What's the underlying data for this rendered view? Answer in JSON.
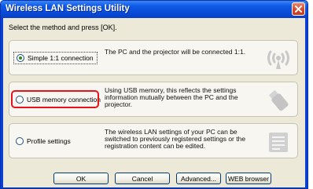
{
  "window": {
    "title": "Wireless LAN Settings Utility",
    "title_bar_color": "#0a3fd6",
    "close_icon": "close-icon"
  },
  "instruction": "Select the method and press [OK].",
  "options": [
    {
      "label": "Simple 1:1 connection",
      "selected": true,
      "description": "The PC and the projector will be connected 1:1.",
      "icon": "wireless-signal-icon"
    },
    {
      "label": "USB memory connection",
      "selected": false,
      "highlighted": true,
      "highlight_color": "#e8121a",
      "description": "Using USB memory, this reflects the settings information mutually between the PC and the projector.",
      "icon": "usb-memory-icon"
    },
    {
      "label": "Profile settings",
      "selected": false,
      "description": "The wireless LAN settings of your PC can be switched to previously registered settings or the registration content can be edited.",
      "icon": "profile-list-icon"
    }
  ],
  "buttons": {
    "ok": "OK",
    "cancel": "Cancel",
    "advanced": "Advanced...",
    "web_browser": "WEB browser"
  }
}
